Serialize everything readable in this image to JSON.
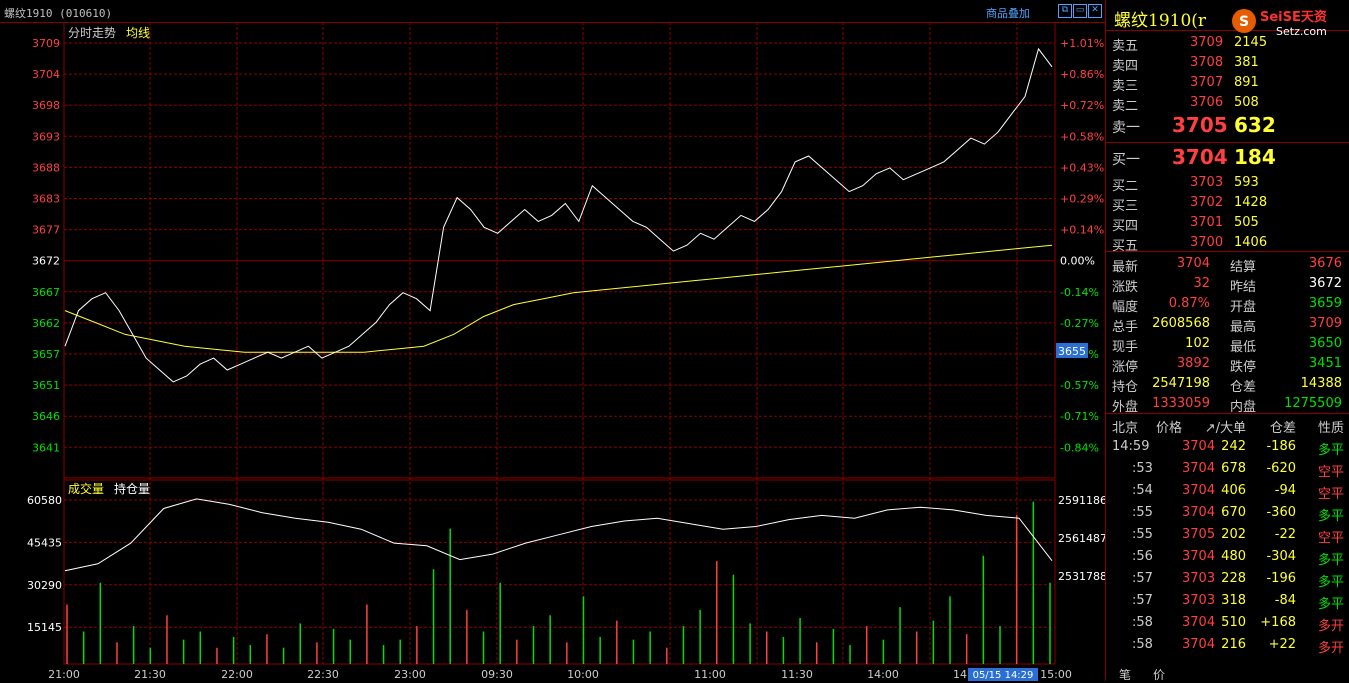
{
  "header": {
    "title": "螺纹1910 (010610)",
    "overlay_label": "商品叠加",
    "btn_icons": [
      "restore-icon",
      "minimize-icon",
      "maximize-icon",
      "close-icon"
    ]
  },
  "price_panel": {
    "title": "分时走势",
    "avg_label": "均线",
    "y_ticks": [
      "3709",
      "3704",
      "3698",
      "3693",
      "3688",
      "3683",
      "3677",
      "3672",
      "3667",
      "3662",
      "3657",
      "3651",
      "3646",
      "3641"
    ],
    "pct_ticks": [
      "+1.01%",
      "+0.86%",
      "+0.72%",
      "+0.58%",
      "+0.43%",
      "+0.29%",
      "+0.14%",
      "0.00%",
      "-0.14%",
      "-0.27%",
      "-0.41%",
      "-0.57%",
      "-0.71%",
      "-0.84%"
    ],
    "cursor_value": "3655"
  },
  "volume_panel": {
    "title": "成交量",
    "oi_label": "持仓量",
    "y_ticks": [
      "60580",
      "45435",
      "30290",
      "15145"
    ],
    "oi_ticks": [
      "2591186",
      "2561487",
      "2531788"
    ]
  },
  "time_axis": [
    "21:00",
    "21:30",
    "22:00",
    "22:30",
    "23:00",
    "09:30",
    "10:00",
    "11:00",
    "11:30",
    "14:00",
    "14",
    "15:00"
  ],
  "cursor_time": "05/15 14:29",
  "quote": {
    "title": "螺纹1910(r",
    "logo_text": "SeiSE天资",
    "logo_sub": "Setz.com",
    "asks": [
      {
        "label": "卖五",
        "price": "3709",
        "vol": "2145"
      },
      {
        "label": "卖四",
        "price": "3708",
        "vol": "381"
      },
      {
        "label": "卖三",
        "price": "3707",
        "vol": "891"
      },
      {
        "label": "卖二",
        "price": "3706",
        "vol": "508"
      },
      {
        "label": "卖一",
        "price": "3705",
        "vol": "632"
      }
    ],
    "bids": [
      {
        "label": "买一",
        "price": "3704",
        "vol": "184"
      },
      {
        "label": "买二",
        "price": "3703",
        "vol": "593"
      },
      {
        "label": "买三",
        "price": "3702",
        "vol": "1428"
      },
      {
        "label": "买四",
        "price": "3701",
        "vol": "505"
      },
      {
        "label": "买五",
        "price": "3700",
        "vol": "1406"
      }
    ],
    "stats": [
      {
        "l1": "最新",
        "v1": "3704",
        "c1": "red",
        "l2": "结算",
        "v2": "3676",
        "c2": "red"
      },
      {
        "l1": "涨跌",
        "v1": "32",
        "c1": "red",
        "l2": "昨结",
        "v2": "3672",
        "c2": "wht"
      },
      {
        "l1": "幅度",
        "v1": "0.87%",
        "c1": "red",
        "l2": "开盘",
        "v2": "3659",
        "c2": "grn"
      },
      {
        "l1": "总手",
        "v1": "2608568",
        "c1": "yel",
        "l2": "最高",
        "v2": "3709",
        "c2": "red"
      },
      {
        "l1": "现手",
        "v1": "102",
        "c1": "yel",
        "l2": "最低",
        "v2": "3650",
        "c2": "grn"
      },
      {
        "l1": "涨停",
        "v1": "3892",
        "c1": "red",
        "l2": "跌停",
        "v2": "3451",
        "c2": "grn"
      },
      {
        "l1": "持仓",
        "v1": "2547198",
        "c1": "yel",
        "l2": "仓差",
        "v2": "14388",
        "c2": "yel"
      },
      {
        "l1": "外盘",
        "v1": "1333059",
        "c1": "red",
        "l2": "内盘",
        "v2": "1275509",
        "c2": "grn"
      }
    ],
    "tick_header": [
      "北京",
      "价格",
      "↗/大单",
      "仓差",
      "性质"
    ],
    "ticks": [
      {
        "t": "14:59",
        "p": "3704",
        "v": "242",
        "d": "-186",
        "n": "多平",
        "nc": "grn"
      },
      {
        "t": ":53",
        "p": "3704",
        "v": "678",
        "d": "-620",
        "n": "空平",
        "nc": "red"
      },
      {
        "t": ":54",
        "p": "3704",
        "v": "406",
        "d": "-94",
        "n": "空平",
        "nc": "red"
      },
      {
        "t": ":55",
        "p": "3704",
        "v": "670",
        "d": "-360",
        "n": "多平",
        "nc": "grn"
      },
      {
        "t": ":55",
        "p": "3705",
        "v": "202",
        "d": "-22",
        "n": "空平",
        "nc": "red"
      },
      {
        "t": ":56",
        "p": "3704",
        "v": "480",
        "d": "-304",
        "n": "多平",
        "nc": "grn"
      },
      {
        "t": ":57",
        "p": "3703",
        "v": "228",
        "d": "-196",
        "n": "多平",
        "nc": "grn"
      },
      {
        "t": ":57",
        "p": "3703",
        "v": "318",
        "d": "-84",
        "n": "多平",
        "nc": "grn"
      },
      {
        "t": ":58",
        "p": "3704",
        "v": "510",
        "d": "+168",
        "n": "多开",
        "nc": "red"
      },
      {
        "t": ":58",
        "p": "3704",
        "v": "216",
        "d": "+22",
        "n": "多开",
        "nc": "red"
      }
    ],
    "tabs": [
      "笔",
      "价"
    ]
  },
  "colors": {
    "grid": "#8b0000",
    "up": "#ff4040",
    "down": "#00e000",
    "avg": "#ffff33",
    "price": "#ffffff",
    "oi": "#ffffff",
    "bg": "#000000"
  },
  "chart_data": {
    "type": "line",
    "price_ylim": [
      3638,
      3712
    ],
    "prev_settle": 3672,
    "price": [
      3658,
      3664,
      3666,
      3667,
      3664,
      3660,
      3656,
      3654,
      3652,
      3653,
      3655,
      3656,
      3654,
      3655,
      3656,
      3657,
      3656,
      3657,
      3658,
      3656,
      3657,
      3658,
      3660,
      3662,
      3665,
      3667,
      3666,
      3664,
      3678,
      3683,
      3681,
      3678,
      3677,
      3679,
      3681,
      3679,
      3680,
      3682,
      3679,
      3685,
      3683,
      3681,
      3679,
      3678,
      3676,
      3674,
      3675,
      3677,
      3676,
      3678,
      3680,
      3679,
      3681,
      3684,
      3689,
      3690,
      3688,
      3686,
      3684,
      3685,
      3687,
      3688,
      3686,
      3687,
      3688,
      3689,
      3691,
      3693,
      3692,
      3694,
      3697,
      3700,
      3708,
      3705
    ],
    "avg": [
      3664,
      3662,
      3660,
      3659,
      3658,
      3657.5,
      3657,
      3657,
      3657,
      3657,
      3657,
      3657.5,
      3658,
      3660,
      3663,
      3665,
      3666,
      3667,
      3667.5,
      3668,
      3668.5,
      3669,
      3669.5,
      3670,
      3670.5,
      3671,
      3671.5,
      3672,
      3672.5,
      3673,
      3673.5,
      3674,
      3674.5,
      3675
    ],
    "volume": [
      22000,
      12000,
      30000,
      8000,
      14000,
      6000,
      18000,
      9000,
      12000,
      6000,
      10000,
      7000,
      11000,
      6000,
      15000,
      8000,
      13000,
      9000,
      22000,
      7000,
      9000,
      14000,
      35000,
      50000,
      20000,
      12000,
      30000,
      9000,
      14000,
      18000,
      8000,
      25000,
      10000,
      16000,
      9000,
      12000,
      6000,
      14000,
      20000,
      38000,
      33000,
      15000,
      12000,
      10000,
      17000,
      8000,
      13000,
      7000,
      14000,
      9000,
      21000,
      12000,
      16000,
      25000,
      11000,
      40000,
      14000,
      55000,
      60000,
      30000
    ],
    "open_interest": [
      2540000,
      2545000,
      2560000,
      2585000,
      2592000,
      2588000,
      2582000,
      2578000,
      2575000,
      2570000,
      2560000,
      2558000,
      2548000,
      2552000,
      2560000,
      2566000,
      2572000,
      2576000,
      2578000,
      2574000,
      2570000,
      2572000,
      2577000,
      2580000,
      2578000,
      2584000,
      2586000,
      2584000,
      2580000,
      2578000,
      2547198
    ],
    "vol_ylim": [
      0,
      62000
    ],
    "oi_ylim": [
      2518000,
      2598000
    ]
  }
}
